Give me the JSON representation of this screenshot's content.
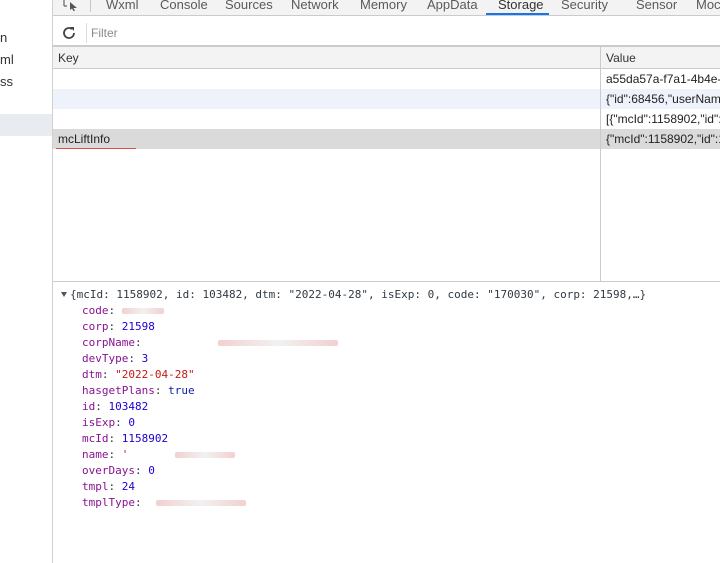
{
  "sidebar": {
    "items": [
      "n",
      "ml",
      "ss"
    ]
  },
  "tabs": [
    {
      "label": "Wxml"
    },
    {
      "label": "Console"
    },
    {
      "label": "Sources"
    },
    {
      "label": "Network"
    },
    {
      "label": "Memory"
    },
    {
      "label": "AppData"
    },
    {
      "label": "Storage"
    },
    {
      "label": "Security"
    },
    {
      "label": "Sensor"
    },
    {
      "label": "Moc"
    }
  ],
  "active_tab": "Storage",
  "filter": {
    "placeholder": "Filter",
    "value": ""
  },
  "table": {
    "columns": [
      "Key",
      "Value"
    ],
    "rows": [
      {
        "key": "",
        "value": "a55da57a-f7a1-4b4e-"
      },
      {
        "key": "",
        "value": "{\"id\":68456,\"userName"
      },
      {
        "key": "",
        "value": "[{\"mcId\":1158902,\"id\":"
      },
      {
        "key": "mcLiftInfo",
        "value": "{\"mcId\":1158902,\"id\":1"
      }
    ]
  },
  "preview": {
    "summary": "{mcId: 1158902, id: 103482, dtm: \"2022-04-28\", isExp: 0, code: \"170030\", corp: 21598,…}",
    "props": [
      {
        "key": "code",
        "value": ""
      },
      {
        "key": "corp",
        "value": "21598"
      },
      {
        "key": "corpName",
        "value": ""
      },
      {
        "key": "devType",
        "value": "3"
      },
      {
        "key": "dtm",
        "value": "\"2022-04-28\""
      },
      {
        "key": "hasgetPlans",
        "value": "true"
      },
      {
        "key": "id",
        "value": "103482"
      },
      {
        "key": "isExp",
        "value": "0"
      },
      {
        "key": "mcId",
        "value": "1158902"
      },
      {
        "key": "name",
        "value": "'"
      },
      {
        "key": "overDays",
        "value": "0"
      },
      {
        "key": "tmpl",
        "value": "24"
      },
      {
        "key": "tmplType",
        "value": ""
      }
    ]
  },
  "colors": {
    "accent": "#1a73e8",
    "selected_row": "#dadada",
    "alt_row": "#eef3fb"
  },
  "icons": [
    "inspect-icon",
    "refresh-icon",
    "expand-triangle-icon"
  ]
}
